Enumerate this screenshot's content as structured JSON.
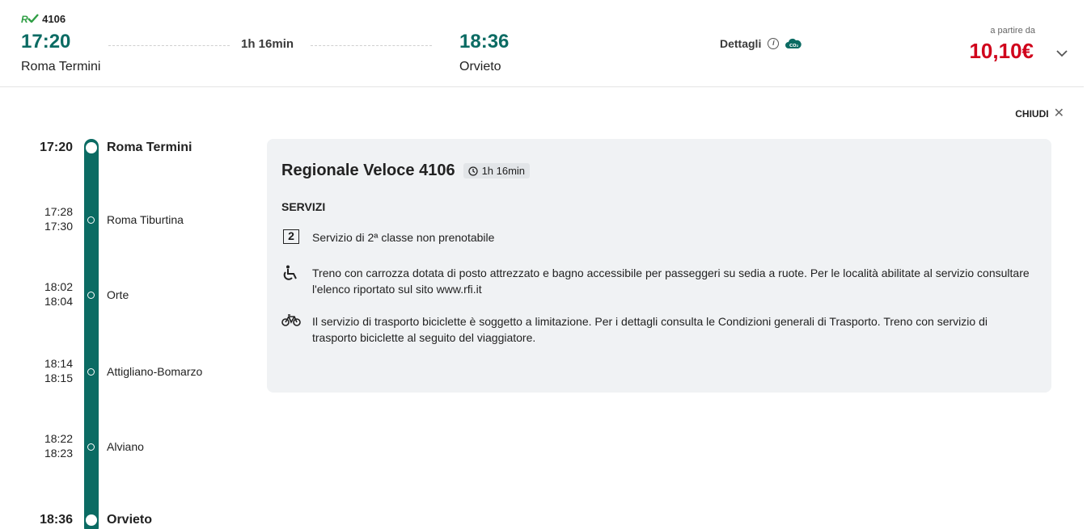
{
  "summary": {
    "brand_logo": "R",
    "train_number": "4106",
    "departure_time": "17:20",
    "departure_station": "Roma Termini",
    "duration": "1h 16min",
    "arrival_time": "18:36",
    "arrival_station": "Orvieto",
    "details_label": "Dettagli",
    "info_icon_glyph": "i",
    "price_label": "a partire da",
    "price": "10,10€",
    "accent_color": "#0b6b63",
    "price_color": "#d0021b"
  },
  "close_label": "CHIUDI",
  "stops": [
    {
      "time_arr": "17:20",
      "time_dep": "",
      "name": "Roma Termini",
      "major": true
    },
    {
      "time_arr": "17:28",
      "time_dep": "17:30",
      "name": "Roma Tiburtina",
      "major": false
    },
    {
      "time_arr": "18:02",
      "time_dep": "18:04",
      "name": "Orte",
      "major": false
    },
    {
      "time_arr": "18:14",
      "time_dep": "18:15",
      "name": "Attigliano-Bomarzo",
      "major": false
    },
    {
      "time_arr": "18:22",
      "time_dep": "18:23",
      "name": "Alviano",
      "major": false
    },
    {
      "time_arr": "18:36",
      "time_dep": "",
      "name": "Orvieto",
      "major": true
    }
  ],
  "detail": {
    "title": "Regionale Veloce 4106",
    "duration": "1h 16min",
    "services_heading": "SERVIZI",
    "services": [
      {
        "icon": "second-class-icon",
        "icon_text": "2",
        "text": "Servizio di 2ª classe non prenotabile"
      },
      {
        "icon": "wheelchair-icon",
        "text": "Treno con carrozza dotata di posto attrezzato e bagno accessibile per passeggeri su sedia a ruote. Per le località abilitate al servizio consultare l'elenco riportato sul sito www.rfi.it"
      },
      {
        "icon": "bicycle-icon",
        "text": "Il servizio di trasporto biciclette è soggetto a limitazione. Per i dettagli consulta le Condizioni generali di Trasporto. Treno con servizio di trasporto biciclette al seguito del viaggiatore."
      }
    ]
  }
}
